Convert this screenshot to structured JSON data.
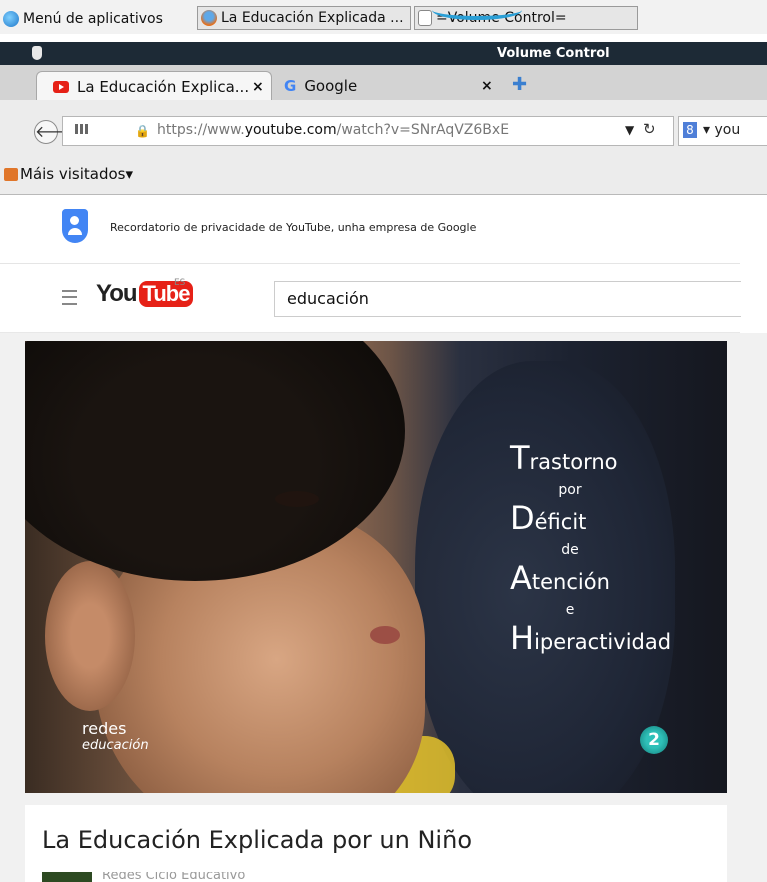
{
  "taskbar": {
    "items": [
      {
        "label": "Menú de aplicativos",
        "icon": "app-menu-icon"
      },
      {
        "label": "La Educación Explicada ...",
        "icon": "firefox-icon"
      },
      {
        "label": "=Volume Control=",
        "icon": "volume-control-icon"
      }
    ]
  },
  "window": {
    "title": "Volume Control"
  },
  "tabs": [
    {
      "label": "La Educación Explica...",
      "close": "×",
      "active": true,
      "icon": "youtube-favicon"
    },
    {
      "label": "Google",
      "close": "×",
      "active": false,
      "icon": "google-favicon"
    }
  ],
  "newtab_symbol": "✚",
  "nav": {
    "url_prefix": "https://www.",
    "url_domain": "youtube.com",
    "url_path": "/watch?v=SNrAqVZ6BxE",
    "search_engine_text": "you"
  },
  "bookmarks": {
    "label": "Máis visitados",
    "arrow": "▾"
  },
  "youtube": {
    "privacy_text": "Recordatorio de privacidade de YouTube, unha empresa de Google",
    "logo_you": "You",
    "logo_tube": "Tube",
    "logo_region": "ES",
    "search_value": "educación"
  },
  "video": {
    "overlay_lines": [
      {
        "cap": "T",
        "rest": "rastorno"
      },
      {
        "small": "por"
      },
      {
        "cap": "D",
        "rest": "éficit"
      },
      {
        "small": "de"
      },
      {
        "cap": "A",
        "rest": "tención"
      },
      {
        "small": "e"
      },
      {
        "cap": "H",
        "rest": "iperactividad"
      }
    ],
    "brand_line1": "redes",
    "brand_line2": "educación",
    "channel_badge": "2",
    "title": "La Educación Explicada por un Niño",
    "channel_name": "Redes Ciclo Educativo"
  },
  "colors": {
    "youtube_red": "#e62117",
    "window_bar": "#1d2a36",
    "link_blue": "#3a7fd0"
  }
}
